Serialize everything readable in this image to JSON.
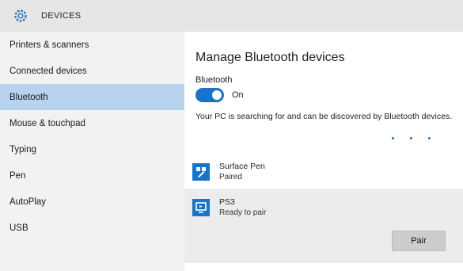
{
  "window": {
    "title": "DEVICES"
  },
  "sidebar": {
    "items": [
      {
        "label": "Printers & scanners"
      },
      {
        "label": "Connected devices"
      },
      {
        "label": "Bluetooth"
      },
      {
        "label": "Mouse & touchpad"
      },
      {
        "label": "Typing"
      },
      {
        "label": "Pen"
      },
      {
        "label": "AutoPlay"
      },
      {
        "label": "USB"
      }
    ],
    "selected_index": 2
  },
  "main": {
    "heading": "Manage Bluetooth devices",
    "bluetooth_label": "Bluetooth",
    "toggle_state": "On",
    "description": "Your PC is searching for and can be discovered by Bluetooth devices.",
    "devices": [
      {
        "name": "Surface Pen",
        "status": "Paired",
        "icon": "pen-icon"
      },
      {
        "name": "PS3",
        "status": "Ready to pair",
        "icon": "display-icon"
      }
    ],
    "pair_button": "Pair"
  },
  "colors": {
    "accent": "#1a73c8",
    "selected_nav": "#b7d3f0",
    "sidebar_bg": "#f2f2f2",
    "titlebar_bg": "#e6e6e6"
  }
}
